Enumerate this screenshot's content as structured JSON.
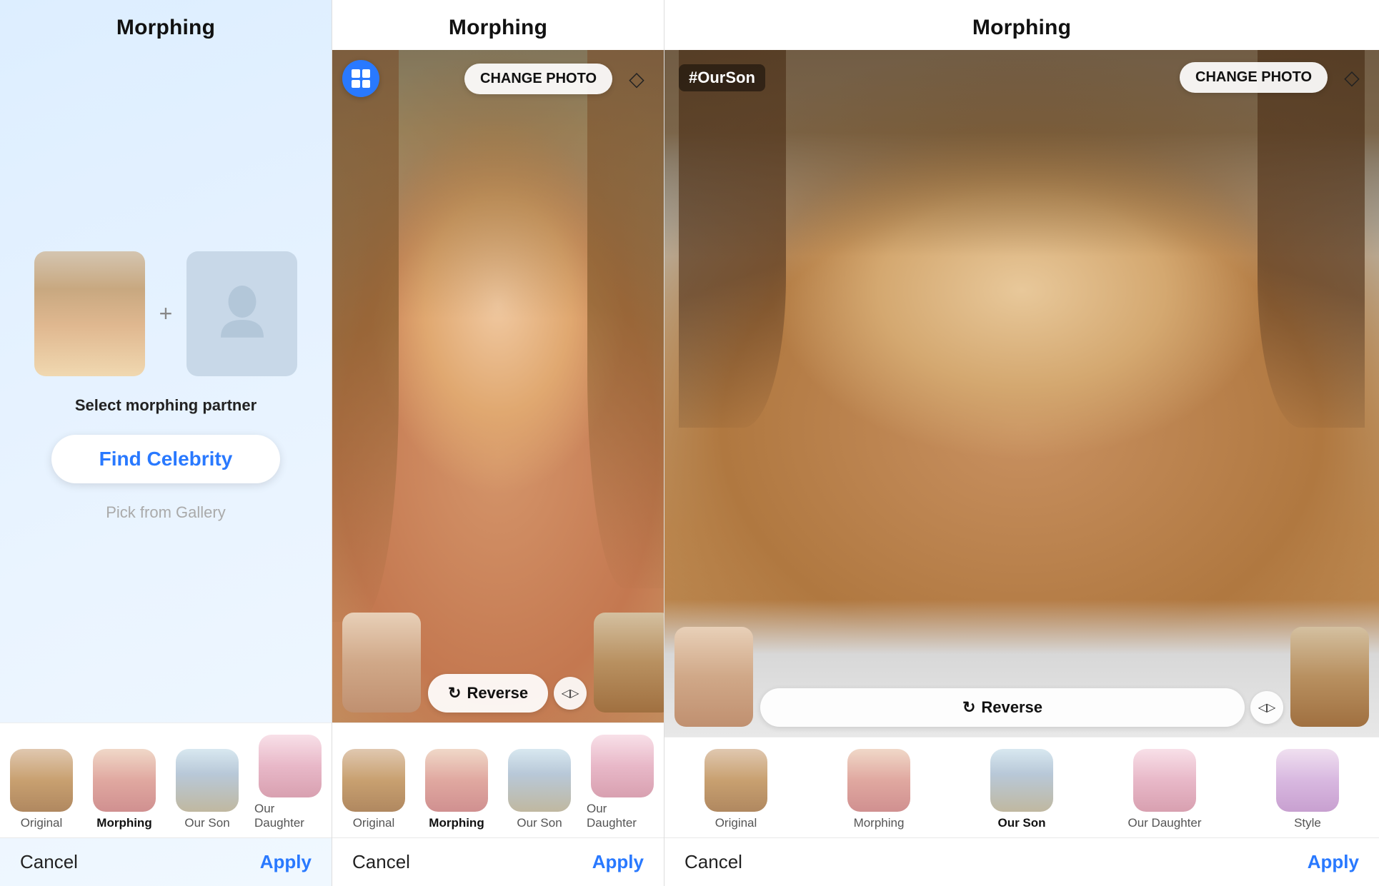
{
  "panel1": {
    "title": "Morphing",
    "select_label": "Select morphing partner",
    "find_celebrity_label": "Find Celebrity",
    "pick_gallery_label": "Pick from Gallery",
    "tabs": [
      {
        "label": "Original",
        "style": "normal",
        "bg": "original"
      },
      {
        "label": "Morphing",
        "style": "bold",
        "bg": "morphing"
      },
      {
        "label": "Our Son",
        "style": "normal",
        "bg": "ourson"
      },
      {
        "label": "Our Daughter",
        "style": "normal",
        "bg": "ourdaughter"
      }
    ],
    "cancel_label": "Cancel",
    "apply_label": "Apply"
  },
  "panel2": {
    "title": "Morphing",
    "change_photo_label": "CHANGE PHOTO",
    "reverse_label": "Reverse",
    "tabs": [
      {
        "label": "Original",
        "style": "normal",
        "bg": "original"
      },
      {
        "label": "Morphing",
        "style": "bold",
        "bg": "morphing"
      },
      {
        "label": "Our Son",
        "style": "normal",
        "bg": "ourson"
      },
      {
        "label": "Our Daughter",
        "style": "normal",
        "bg": "ourdaughter"
      }
    ],
    "cancel_label": "Cancel",
    "apply_label": "Apply"
  },
  "panel3": {
    "title": "Morphing",
    "hashtag": "#OurSon",
    "change_photo_label": "CHANGE PHOTO",
    "reverse_label": "Reverse",
    "tabs": [
      {
        "label": "Original",
        "style": "normal",
        "bg": "original"
      },
      {
        "label": "Morphing",
        "style": "normal",
        "bg": "morphing"
      },
      {
        "label": "Our Son",
        "style": "bold",
        "bg": "ourson"
      },
      {
        "label": "Our Daughter",
        "style": "normal",
        "bg": "ourdaughter"
      },
      {
        "label": "Style",
        "style": "normal",
        "bg": "style"
      }
    ],
    "cancel_label": "Cancel",
    "apply_label": "Apply"
  },
  "icons": {
    "grid": "⊞",
    "eraser": "◇",
    "reverse": "↻",
    "expand": "◁▷"
  }
}
